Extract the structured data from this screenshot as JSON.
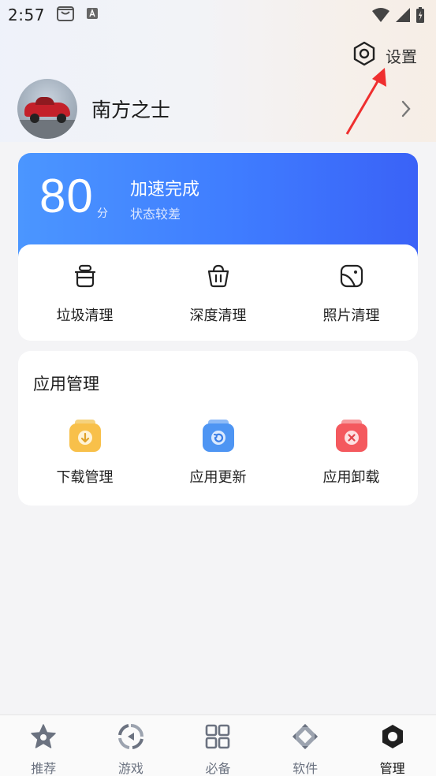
{
  "status_bar": {
    "time": "2:57"
  },
  "header": {
    "settings_label": "设置"
  },
  "profile": {
    "name": "南方之士"
  },
  "score_card": {
    "score": "80",
    "unit": "分",
    "title": "加速完成",
    "subtitle": "状态较差",
    "tools": [
      {
        "label": "垃圾清理",
        "icon": "trash-bin-icon"
      },
      {
        "label": "深度清理",
        "icon": "basket-icon"
      },
      {
        "label": "照片清理",
        "icon": "photo-icon"
      }
    ]
  },
  "app_management": {
    "title": "应用管理",
    "items": [
      {
        "label": "下载管理",
        "icon": "download-icon",
        "color": "#f8c04a"
      },
      {
        "label": "应用更新",
        "icon": "update-icon",
        "color": "#4e95f3"
      },
      {
        "label": "应用卸载",
        "icon": "uninstall-icon",
        "color": "#f4595e"
      }
    ]
  },
  "bottom_nav": {
    "items": [
      {
        "label": "推荐",
        "icon": "star-icon"
      },
      {
        "label": "游戏",
        "icon": "game-icon"
      },
      {
        "label": "必备",
        "icon": "grid-icon"
      },
      {
        "label": "软件",
        "icon": "diamond-icon"
      },
      {
        "label": "管理",
        "icon": "manage-icon",
        "active": true
      }
    ]
  },
  "colors": {
    "accent_blue": "#3f7cff",
    "background": "#f4f4f6"
  }
}
